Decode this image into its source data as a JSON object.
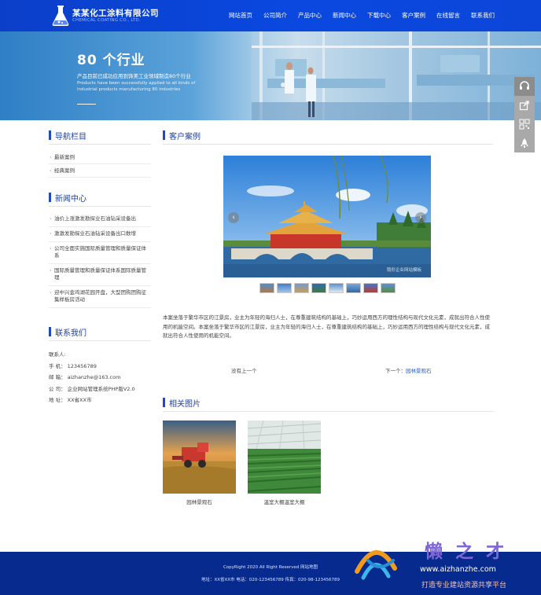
{
  "header": {
    "logo_cn": "某某化工涂料有限公司",
    "logo_en": "CHEMICAL COATING CO., LTD.",
    "nav": [
      "网站首页",
      "公司简介",
      "产品中心",
      "新闻中心",
      "下载中心",
      "客户案例",
      "在线留言",
      "联系我们"
    ]
  },
  "banner": {
    "title": "80 个行业",
    "subtitle": "产品目前已成功应用到饰美工业领域制造80个行业",
    "subtitle_en": "Products have been successfully applied to all kinds of industrial products manufacturing 80 industries"
  },
  "side_tools": [
    "headset-icon",
    "share-icon",
    "qrcode-icon",
    "rocket-icon"
  ],
  "left": {
    "nav_title": "导航栏目",
    "categories": [
      "最新案例",
      "经典案例"
    ],
    "news_title": "新闻中心",
    "news": [
      "油价上涨激发勘探业石油钻采设备出",
      "激激发勘探业石油钻采设备出口数增",
      "公司全面实施国际质量管理和质量保证体系",
      "国际质量管理和质量保证体系国际质量管理",
      "迎中兴金鸡湖花园开盘，大型团购团购征集样板房活动"
    ],
    "contact_title": "联系我们",
    "contact": [
      "联系人:",
      "手 机： 123456789",
      "邮 箱： aizhanzhe@163.com",
      "公 司： 企业网站管理系统PHP版V2.0",
      "地 址： XX省XX市"
    ]
  },
  "main": {
    "section_title": "客户案例",
    "carousel": {
      "prev": "‹",
      "next": "›",
      "watermark": "隐形企业网站模板"
    },
    "article": "本案坐落于繁华市区的江景房，业主为年轻的海归人士，在尊重建筑结构的基础上，巧妙运用西方的理性结构与现代文化元素，成就出符合人性使用的机能空间。本案坐落于繁华市区的江景房，业主为年轻的海归人士，在尊重建筑结构的基础上，巧妙运用西方的理性结构与现代文化元素，成就出符合人性使用的机能空间。",
    "prev_text": "没有上一个",
    "next_label": "下一个：",
    "next_link": "园林景观石",
    "related_title": "相关图片",
    "related": [
      "园林景观石",
      "温室大棚温室大棚"
    ]
  },
  "footer": {
    "copyright": "CopyRight 2020 All Right Reserved  网站地图",
    "info": "地址：XX省XX市  电话：020-123456789  传真：020-98-123456789"
  },
  "watermark": {
    "brand": "懒之才",
    "url": "www.aizhanzhe.com",
    "slogan": "打造专业建站资源共享平台"
  },
  "colors": {
    "brand_blue": "#0a48e0",
    "title_blue": "#1b3fa6",
    "footer_blue": "#072a8f"
  }
}
